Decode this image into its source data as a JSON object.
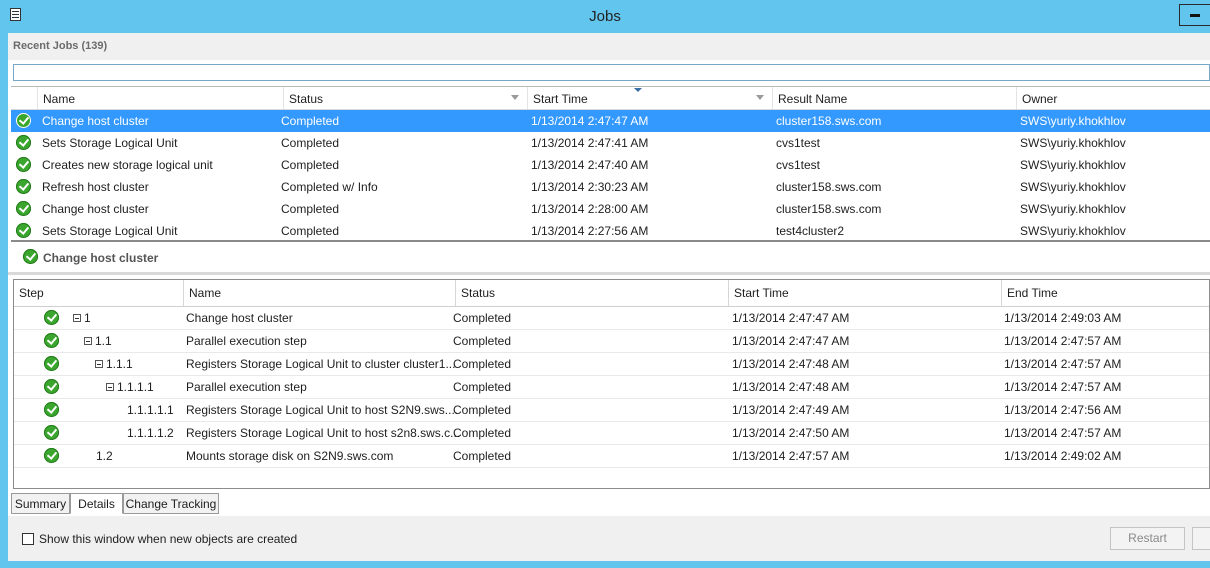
{
  "window": {
    "title": "Jobs"
  },
  "recent_jobs": {
    "header": "Recent Jobs (139)",
    "columns": [
      "Name",
      "Status",
      "Start Time",
      "Result Name",
      "Owner"
    ],
    "rows": [
      {
        "name": "Change host cluster",
        "status": "Completed",
        "start_time": "1/13/2014 2:47:47 AM",
        "result_name": "cluster158.sws.com",
        "owner": "SWS\\yuriy.khokhlov",
        "selected": true
      },
      {
        "name": "Sets Storage Logical Unit",
        "status": "Completed",
        "start_time": "1/13/2014 2:47:41 AM",
        "result_name": "cvs1test",
        "owner": "SWS\\yuriy.khokhlov"
      },
      {
        "name": "Creates new storage logical unit",
        "status": "Completed",
        "start_time": "1/13/2014 2:47:40 AM",
        "result_name": "cvs1test",
        "owner": "SWS\\yuriy.khokhlov"
      },
      {
        "name": "Refresh host cluster",
        "status": "Completed w/ Info",
        "start_time": "1/13/2014 2:30:23 AM",
        "result_name": "cluster158.sws.com",
        "owner": "SWS\\yuriy.khokhlov"
      },
      {
        "name": "Change host cluster",
        "status": "Completed",
        "start_time": "1/13/2014 2:28:00 AM",
        "result_name": "cluster158.sws.com",
        "owner": "SWS\\yuriy.khokhlov"
      },
      {
        "name": "Sets Storage Logical Unit",
        "status": "Completed",
        "start_time": "1/13/2014 2:27:56 AM",
        "result_name": "test4cluster2",
        "owner": "SWS\\yuriy.khokhlov"
      }
    ]
  },
  "details": {
    "title": "Change host cluster",
    "columns": [
      "Step",
      "Name",
      "Status",
      "Start Time",
      "End Time"
    ],
    "steps": [
      {
        "step": "1",
        "name": "Change host cluster",
        "status": "Completed",
        "start_time": "1/13/2014 2:47:47 AM",
        "end_time": "1/13/2014 2:49:03 AM",
        "level": 0,
        "expandable": true
      },
      {
        "step": "1.1",
        "name": "Parallel execution step",
        "status": "Completed",
        "start_time": "1/13/2014 2:47:47 AM",
        "end_time": "1/13/2014 2:47:57 AM",
        "level": 1,
        "expandable": true
      },
      {
        "step": "1.1.1",
        "name": "Registers Storage Logical Unit to cluster cluster1...",
        "status": "Completed",
        "start_time": "1/13/2014 2:47:48 AM",
        "end_time": "1/13/2014 2:47:57 AM",
        "level": 2,
        "expandable": true
      },
      {
        "step": "1.1.1.1",
        "name": "Parallel execution step",
        "status": "Completed",
        "start_time": "1/13/2014 2:47:48 AM",
        "end_time": "1/13/2014 2:47:57 AM",
        "level": 3,
        "expandable": true
      },
      {
        "step": "1.1.1.1.1",
        "name": "Registers Storage Logical Unit to host S2N9.sws....",
        "status": "Completed",
        "start_time": "1/13/2014 2:47:49 AM",
        "end_time": "1/13/2014 2:47:56 AM",
        "level": 4,
        "expandable": false
      },
      {
        "step": "1.1.1.1.2",
        "name": "Registers Storage Logical Unit to host s2n8.sws.c...",
        "status": "Completed",
        "start_time": "1/13/2014 2:47:50 AM",
        "end_time": "1/13/2014 2:47:57 AM",
        "level": 4,
        "expandable": false
      },
      {
        "step": "1.2",
        "name": "Mounts storage disk on S2N9.sws.com",
        "status": "Completed",
        "start_time": "1/13/2014 2:47:57 AM",
        "end_time": "1/13/2014 2:49:02 AM",
        "level": 2,
        "expandable": false
      }
    ]
  },
  "tabs": [
    {
      "label": "Summary",
      "active": false
    },
    {
      "label": "Details",
      "active": true
    },
    {
      "label": "Change Tracking",
      "active": false
    }
  ],
  "footer": {
    "checkbox_label": "Show this window when new objects are created",
    "checkbox_checked": false,
    "restart_label": "Restart"
  },
  "icons": {
    "status": "check-circle-icon",
    "expander": "collapse-minus-icon",
    "window": "document-icon",
    "minimize": "minimize-icon"
  },
  "colors": {
    "titlebar": "#62c5ee",
    "selection": "#3399ff",
    "success": "#3aa62e"
  }
}
